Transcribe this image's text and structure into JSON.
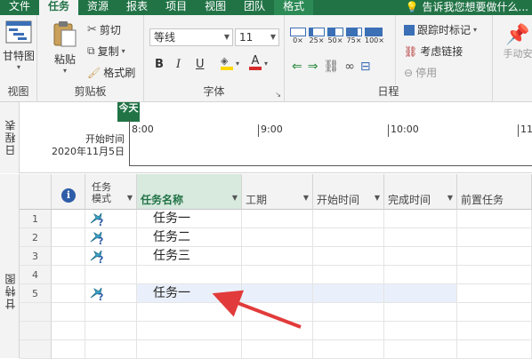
{
  "tabs": [
    "文件",
    "任务",
    "资源",
    "报表",
    "项目",
    "视图",
    "团队",
    "格式"
  ],
  "tell_me": "告诉我您想要做什么...",
  "ribbon": {
    "view_group": {
      "label": "视图",
      "gantt": "甘特图"
    },
    "clipboard_group": {
      "label": "剪贴板",
      "paste": "粘贴",
      "cut": "剪切",
      "copy": "复制",
      "format_painter": "格式刷"
    },
    "font_group": {
      "label": "字体",
      "font_name": "等线",
      "font_size": "11",
      "bold": "B",
      "italic": "I",
      "underline": "U",
      "font_color": "A"
    },
    "schedule_group": {
      "label": "日程",
      "pcts": [
        "0×",
        "25×",
        "50×",
        "75×",
        "100×"
      ],
      "track": "跟踪时标记",
      "respect_links": "考虑链接",
      "inactivate": "停用"
    },
    "manual": "手动安"
  },
  "timeline": {
    "side_label": "日程表",
    "today": "今天",
    "start_label": "开始时间",
    "start_date": "2020年11月5日",
    "ticks": [
      "8:00",
      "9:00",
      "10:00",
      "11"
    ]
  },
  "grid": {
    "side_label": "甘特图",
    "headers": {
      "info": "i",
      "mode": "任务模式",
      "name": "任务名称",
      "duration": "工期",
      "start": "开始时间",
      "finish": "完成时间",
      "pred": "前置任务"
    },
    "rows": [
      {
        "num": "1",
        "name": "任务一"
      },
      {
        "num": "2",
        "name": "任务二"
      },
      {
        "num": "3",
        "name": "任务三"
      },
      {
        "num": "4",
        "name": ""
      },
      {
        "num": "5",
        "name": "任务一"
      }
    ]
  },
  "colors": {
    "brand": "#217346",
    "arrow": "#e23b3b"
  }
}
